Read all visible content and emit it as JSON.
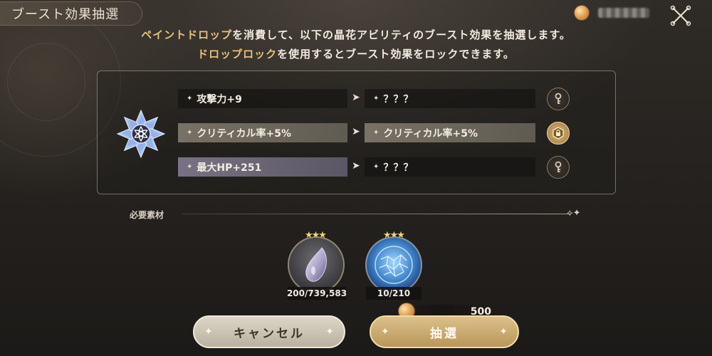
{
  "header": {
    "title": "ブースト効果抽選",
    "currency_value": "*** ****",
    "icons": {
      "currency": "coin-icon",
      "close": "close-x-icon"
    }
  },
  "instructions": {
    "line1_highlight": "ペイントドロップ",
    "line1_rest": "を消費して、以下の晶花アビリティのブースト効果を抽選します。",
    "line2_highlight": "ドロップロック",
    "line2_rest": "を使用するとブースト効果をロックできます。"
  },
  "boost_rows": [
    {
      "current": "攻撃力+9",
      "result": "？？？",
      "locked": false
    },
    {
      "current": "クリティカル率+5%",
      "result": "クリティカル率+5%",
      "locked": true
    },
    {
      "current": "最大HP+251",
      "result": "？？？",
      "locked": false
    }
  ],
  "materials": {
    "label": "必要素材",
    "items": [
      {
        "name": "paint-drop",
        "stars": "★★★",
        "count": "200/739,583"
      },
      {
        "name": "drop-lock",
        "stars": "★★★",
        "count": "10/210"
      }
    ]
  },
  "cost": {
    "value": "500"
  },
  "buttons": {
    "cancel": "キャンセル",
    "draw": "抽選"
  },
  "colors": {
    "highlight": "#e6c178",
    "accent_gold": "#d4b47a"
  }
}
